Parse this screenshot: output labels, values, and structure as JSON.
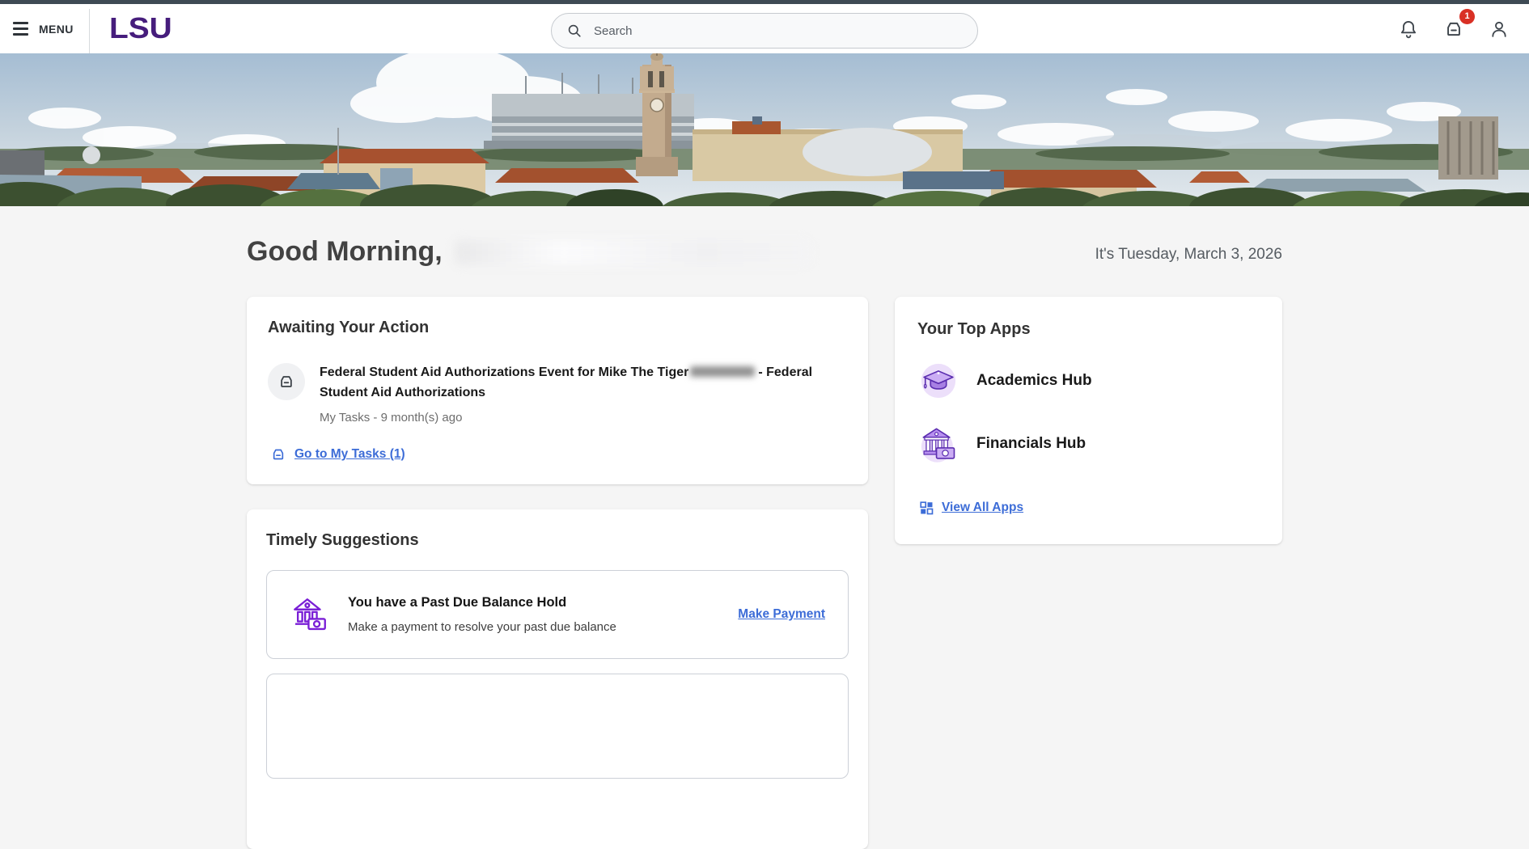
{
  "topbar": {
    "menu_label": "MENU",
    "logo_text": "LSU",
    "search_placeholder": "Search",
    "notifications_badge": "1"
  },
  "greeting": {
    "title": "Good Morning,",
    "date_text": "It's Tuesday, March 3, 2026"
  },
  "awaiting_card": {
    "title": "Awaiting Your Action",
    "task": {
      "title_before": "Federal Student Aid Authorizations Event for Mike The Tiger",
      "title_after": "- Federal Student Aid Authorizations",
      "meta": "My Tasks - 9 month(s) ago"
    },
    "tasks_link_label": "Go to My Tasks (1)"
  },
  "apps_card": {
    "title": "Your Top Apps",
    "apps": [
      {
        "label": "Academics Hub",
        "icon": "graduation-cap-icon"
      },
      {
        "label": "Financials Hub",
        "icon": "bank-money-icon"
      }
    ],
    "view_all_label": "View All Apps"
  },
  "suggestions_card": {
    "title": "Timely Suggestions",
    "items": [
      {
        "icon": "bank-outline-icon",
        "title": "You have a Past Due Balance Hold",
        "description": "Make a payment to resolve your past due balance",
        "action_label": "Make Payment"
      }
    ]
  },
  "hero": {
    "description": "LSU campus aerial panorama with Memorial Tower and Tiger Stadium"
  },
  "colors": {
    "lsu_purple": "#461D7C",
    "link_blue": "#3C6CD7",
    "badge_red": "#D93025",
    "top_strip": "#3E4A54",
    "page_background": "#F5F5F5",
    "app_icon_purple": "#6B3FD4"
  }
}
